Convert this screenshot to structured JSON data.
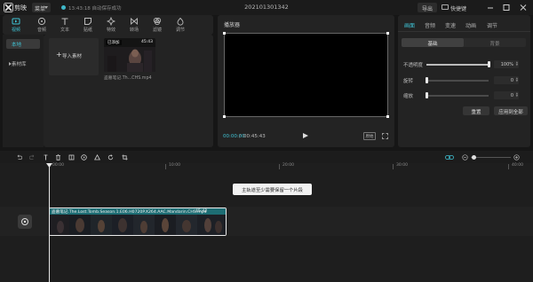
{
  "titlebar": {
    "app_name": "剪映",
    "menu_label": "菜单",
    "save_status": "13:43:18 自动保存成功",
    "project_title": "202101301342",
    "export_label": "导出",
    "shortcut_label": "快捷键"
  },
  "media_toolbar": {
    "items": [
      {
        "label": "视频",
        "icon": "video-icon"
      },
      {
        "label": "音频",
        "icon": "audio-icon"
      },
      {
        "label": "文本",
        "icon": "text-icon"
      },
      {
        "label": "贴纸",
        "icon": "sticker-icon"
      },
      {
        "label": "特效",
        "icon": "effects-icon"
      },
      {
        "label": "转场",
        "icon": "transition-icon"
      },
      {
        "label": "滤镜",
        "icon": "filter-icon"
      },
      {
        "label": "调节",
        "icon": "adjust-icon"
      }
    ],
    "active_index": 0
  },
  "media_side": {
    "local_label": "本地",
    "library_label": "素材库"
  },
  "media_content": {
    "import_label": "导入素材",
    "clip_tag": "已添加",
    "clip_duration": "45:43",
    "clip_name": "盗墓笔记.Th...CHS.mp4"
  },
  "player": {
    "title": "播放器",
    "current_time": "00:00:00",
    "separator": "/",
    "total_time": "00:45:43",
    "ratio_label": "原始"
  },
  "properties": {
    "tabs": [
      "画面",
      "音频",
      "变速",
      "动画",
      "调节"
    ],
    "active_tab": 0,
    "seg_basic": "基础",
    "seg_background": "背景",
    "rows": [
      {
        "label": "不透明度",
        "value": "100%",
        "fraction": 1.0
      },
      {
        "label": "旋转",
        "value": "0",
        "fraction": 0.0
      },
      {
        "label": "缩放",
        "value": "0",
        "fraction": 0.0
      }
    ],
    "reset_label": "重置",
    "apply_all_label": "应用到全部"
  },
  "timeline": {
    "ruler_labels": [
      "00:00",
      "10:00",
      "20:00",
      "30:00",
      "40:00"
    ],
    "tip": "主轨道至少需要保留一个片段",
    "clip_title": "盗墓笔记.The.Lost.Tomb.Season.1.E06.H0720P.X264.AAC.Mandarin.CHS.mp4",
    "clip_duration": "45:42"
  },
  "colors": {
    "accent": "#3fc4d6",
    "clip_header": "#1d6d74",
    "background": "#161616",
    "panel": "#232323"
  }
}
